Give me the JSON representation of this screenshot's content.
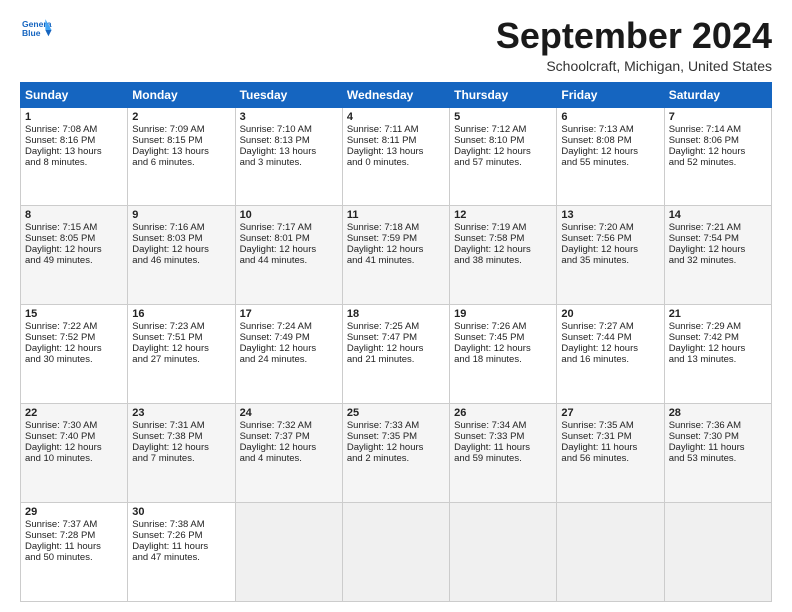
{
  "logo": {
    "line1": "General",
    "line2": "Blue"
  },
  "title": "September 2024",
  "location": "Schoolcraft, Michigan, United States",
  "days_header": [
    "Sunday",
    "Monday",
    "Tuesday",
    "Wednesday",
    "Thursday",
    "Friday",
    "Saturday"
  ],
  "weeks": [
    [
      {
        "day": "1",
        "lines": [
          "Sunrise: 7:08 AM",
          "Sunset: 8:16 PM",
          "Daylight: 13 hours",
          "and 8 minutes."
        ]
      },
      {
        "day": "2",
        "lines": [
          "Sunrise: 7:09 AM",
          "Sunset: 8:15 PM",
          "Daylight: 13 hours",
          "and 6 minutes."
        ]
      },
      {
        "day": "3",
        "lines": [
          "Sunrise: 7:10 AM",
          "Sunset: 8:13 PM",
          "Daylight: 13 hours",
          "and 3 minutes."
        ]
      },
      {
        "day": "4",
        "lines": [
          "Sunrise: 7:11 AM",
          "Sunset: 8:11 PM",
          "Daylight: 13 hours",
          "and 0 minutes."
        ]
      },
      {
        "day": "5",
        "lines": [
          "Sunrise: 7:12 AM",
          "Sunset: 8:10 PM",
          "Daylight: 12 hours",
          "and 57 minutes."
        ]
      },
      {
        "day": "6",
        "lines": [
          "Sunrise: 7:13 AM",
          "Sunset: 8:08 PM",
          "Daylight: 12 hours",
          "and 55 minutes."
        ]
      },
      {
        "day": "7",
        "lines": [
          "Sunrise: 7:14 AM",
          "Sunset: 8:06 PM",
          "Daylight: 12 hours",
          "and 52 minutes."
        ]
      }
    ],
    [
      {
        "day": "8",
        "lines": [
          "Sunrise: 7:15 AM",
          "Sunset: 8:05 PM",
          "Daylight: 12 hours",
          "and 49 minutes."
        ]
      },
      {
        "day": "9",
        "lines": [
          "Sunrise: 7:16 AM",
          "Sunset: 8:03 PM",
          "Daylight: 12 hours",
          "and 46 minutes."
        ]
      },
      {
        "day": "10",
        "lines": [
          "Sunrise: 7:17 AM",
          "Sunset: 8:01 PM",
          "Daylight: 12 hours",
          "and 44 minutes."
        ]
      },
      {
        "day": "11",
        "lines": [
          "Sunrise: 7:18 AM",
          "Sunset: 7:59 PM",
          "Daylight: 12 hours",
          "and 41 minutes."
        ]
      },
      {
        "day": "12",
        "lines": [
          "Sunrise: 7:19 AM",
          "Sunset: 7:58 PM",
          "Daylight: 12 hours",
          "and 38 minutes."
        ]
      },
      {
        "day": "13",
        "lines": [
          "Sunrise: 7:20 AM",
          "Sunset: 7:56 PM",
          "Daylight: 12 hours",
          "and 35 minutes."
        ]
      },
      {
        "day": "14",
        "lines": [
          "Sunrise: 7:21 AM",
          "Sunset: 7:54 PM",
          "Daylight: 12 hours",
          "and 32 minutes."
        ]
      }
    ],
    [
      {
        "day": "15",
        "lines": [
          "Sunrise: 7:22 AM",
          "Sunset: 7:52 PM",
          "Daylight: 12 hours",
          "and 30 minutes."
        ]
      },
      {
        "day": "16",
        "lines": [
          "Sunrise: 7:23 AM",
          "Sunset: 7:51 PM",
          "Daylight: 12 hours",
          "and 27 minutes."
        ]
      },
      {
        "day": "17",
        "lines": [
          "Sunrise: 7:24 AM",
          "Sunset: 7:49 PM",
          "Daylight: 12 hours",
          "and 24 minutes."
        ]
      },
      {
        "day": "18",
        "lines": [
          "Sunrise: 7:25 AM",
          "Sunset: 7:47 PM",
          "Daylight: 12 hours",
          "and 21 minutes."
        ]
      },
      {
        "day": "19",
        "lines": [
          "Sunrise: 7:26 AM",
          "Sunset: 7:45 PM",
          "Daylight: 12 hours",
          "and 18 minutes."
        ]
      },
      {
        "day": "20",
        "lines": [
          "Sunrise: 7:27 AM",
          "Sunset: 7:44 PM",
          "Daylight: 12 hours",
          "and 16 minutes."
        ]
      },
      {
        "day": "21",
        "lines": [
          "Sunrise: 7:29 AM",
          "Sunset: 7:42 PM",
          "Daylight: 12 hours",
          "and 13 minutes."
        ]
      }
    ],
    [
      {
        "day": "22",
        "lines": [
          "Sunrise: 7:30 AM",
          "Sunset: 7:40 PM",
          "Daylight: 12 hours",
          "and 10 minutes."
        ]
      },
      {
        "day": "23",
        "lines": [
          "Sunrise: 7:31 AM",
          "Sunset: 7:38 PM",
          "Daylight: 12 hours",
          "and 7 minutes."
        ]
      },
      {
        "day": "24",
        "lines": [
          "Sunrise: 7:32 AM",
          "Sunset: 7:37 PM",
          "Daylight: 12 hours",
          "and 4 minutes."
        ]
      },
      {
        "day": "25",
        "lines": [
          "Sunrise: 7:33 AM",
          "Sunset: 7:35 PM",
          "Daylight: 12 hours",
          "and 2 minutes."
        ]
      },
      {
        "day": "26",
        "lines": [
          "Sunrise: 7:34 AM",
          "Sunset: 7:33 PM",
          "Daylight: 11 hours",
          "and 59 minutes."
        ]
      },
      {
        "day": "27",
        "lines": [
          "Sunrise: 7:35 AM",
          "Sunset: 7:31 PM",
          "Daylight: 11 hours",
          "and 56 minutes."
        ]
      },
      {
        "day": "28",
        "lines": [
          "Sunrise: 7:36 AM",
          "Sunset: 7:30 PM",
          "Daylight: 11 hours",
          "and 53 minutes."
        ]
      }
    ],
    [
      {
        "day": "29",
        "lines": [
          "Sunrise: 7:37 AM",
          "Sunset: 7:28 PM",
          "Daylight: 11 hours",
          "and 50 minutes."
        ]
      },
      {
        "day": "30",
        "lines": [
          "Sunrise: 7:38 AM",
          "Sunset: 7:26 PM",
          "Daylight: 11 hours",
          "and 47 minutes."
        ]
      },
      null,
      null,
      null,
      null,
      null
    ]
  ]
}
